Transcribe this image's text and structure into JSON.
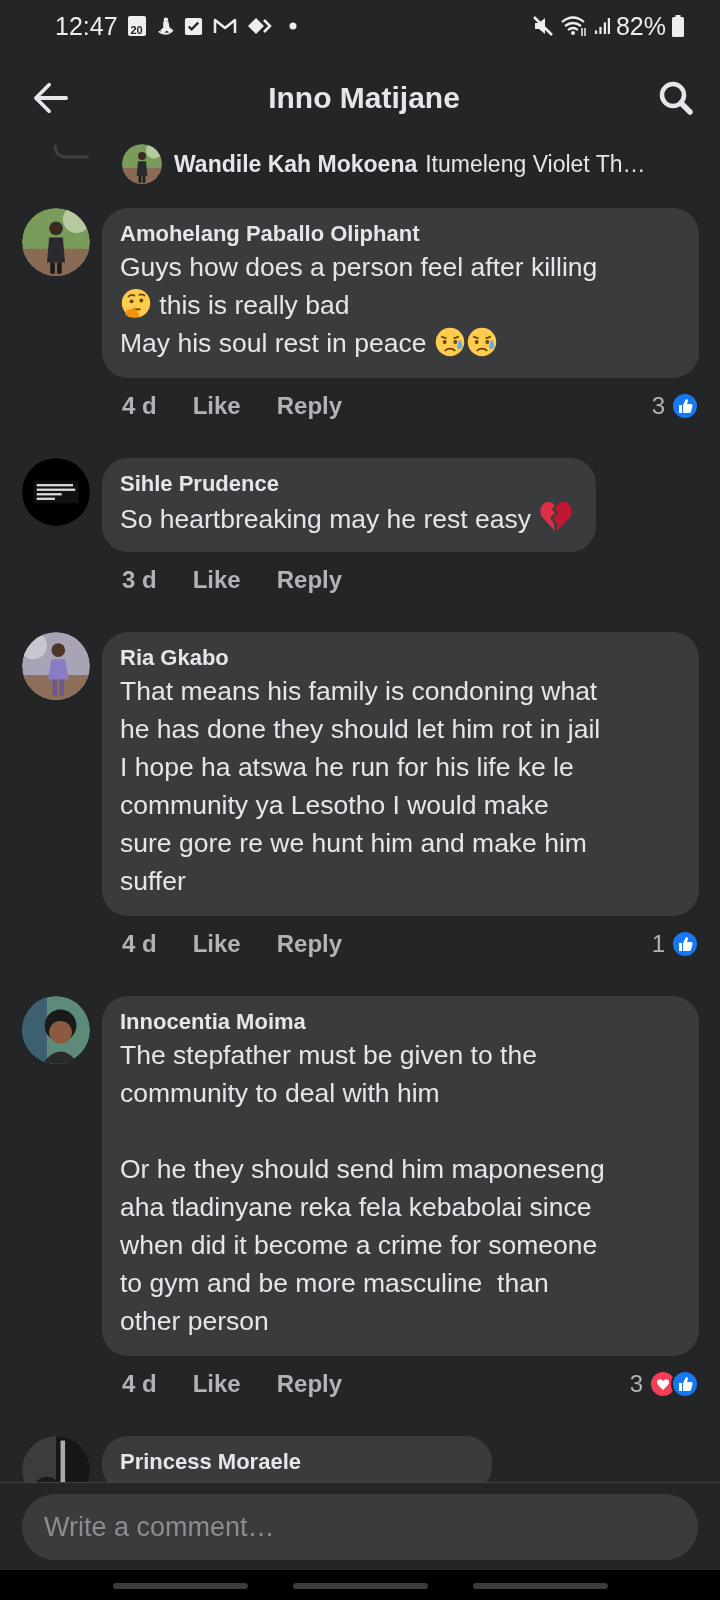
{
  "status_bar": {
    "time": "12:47",
    "calendar_day": "20",
    "battery": "82%"
  },
  "header": {
    "title": "Inno Matijane"
  },
  "reply_summary": {
    "author": "Wandile Kah Mokoena",
    "preview": "Itumeleng Violet Th…"
  },
  "comments": [
    {
      "author": "Amohelang Paballo Oliphant",
      "paragraphs": [
        [
          [
            "Guys how does a person feel after killing"
          ],
          [
            {
              "kind": "thinking"
            },
            " this is really bad"
          ],
          [
            "May his soul rest in peace ",
            {
              "kind": "sad"
            },
            {
              "kind": "sad"
            }
          ]
        ]
      ],
      "time": "4 d",
      "like": "Like",
      "reply": "Reply",
      "reactions": {
        "count": "3",
        "kinds": [
          {
            "kind": "like"
          }
        ]
      }
    },
    {
      "author": "Sihle Prudence",
      "paragraphs": [
        [
          [
            "So heartbreaking may he rest easy ",
            {
              "kind": "broken-heart"
            }
          ]
        ]
      ],
      "time": "3 d",
      "like": "Like",
      "reply": "Reply"
    },
    {
      "author": "Ria Gkabo",
      "paragraphs": [
        [
          [
            "That means his family is condoning what"
          ],
          [
            "he has done they should let him rot in jail"
          ],
          [
            "I hope ha atswa he run for his life ke le"
          ],
          [
            "community ya Lesotho I would make"
          ],
          [
            "sure gore re we hunt him and make him"
          ],
          [
            "suffer"
          ]
        ]
      ],
      "time": "4 d",
      "like": "Like",
      "reply": "Reply",
      "reactions": {
        "count": "1",
        "kinds": [
          {
            "kind": "like"
          }
        ]
      }
    },
    {
      "author": "Innocentia Moima",
      "paragraphs": [
        [
          [
            "The stepfather must be given to the"
          ],
          [
            "community to deal with him"
          ]
        ],
        [
          [
            "Or he they should send him maponeseng"
          ],
          [
            "aha tladinyane reka fela kebabolai since"
          ],
          [
            "when did it become a crime for someone"
          ],
          [
            "to gym and be more masculine  than"
          ],
          [
            "other person"
          ]
        ]
      ],
      "time": "4 d",
      "like": "Like",
      "reply": "Reply",
      "reactions": {
        "count": "3",
        "kinds": [
          {
            "kind": "heart"
          },
          {
            "kind": "like"
          }
        ]
      }
    },
    {
      "author": "Princess Moraele"
    }
  ],
  "composer": {
    "placeholder": "Write a comment…"
  }
}
